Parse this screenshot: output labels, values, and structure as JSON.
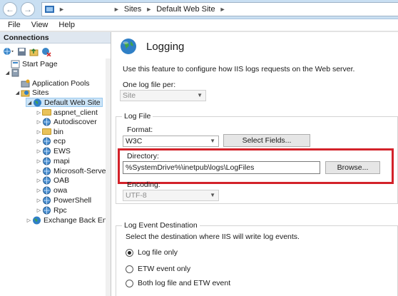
{
  "address_bar": {
    "crumbs": [
      "Sites",
      "Default Web Site"
    ]
  },
  "menu": [
    "File",
    "View",
    "Help"
  ],
  "connections": {
    "title": "Connections",
    "tree": [
      {
        "label": "Start Page",
        "icon": "start-page-icon",
        "depth": 0,
        "expand": ""
      },
      {
        "label": "",
        "icon": "server-icon",
        "depth": 0,
        "expand": "open"
      },
      {
        "label": "Application Pools",
        "icon": "app-pools-icon",
        "depth": 1,
        "expand": ""
      },
      {
        "label": "Sites",
        "icon": "sites-icon",
        "depth": 1,
        "expand": "open"
      },
      {
        "label": "Default Web Site",
        "icon": "globe-icon",
        "depth": 2,
        "expand": "open",
        "selected": true
      },
      {
        "label": "aspnet_client",
        "icon": "folder-icon",
        "depth": 3,
        "expand": "closed"
      },
      {
        "label": "Autodiscover",
        "icon": "app-icon",
        "depth": 3,
        "expand": "closed"
      },
      {
        "label": "bin",
        "icon": "folder-icon",
        "depth": 3,
        "expand": "closed"
      },
      {
        "label": "ecp",
        "icon": "app-icon",
        "depth": 3,
        "expand": "closed"
      },
      {
        "label": "EWS",
        "icon": "app-icon",
        "depth": 3,
        "expand": "closed"
      },
      {
        "label": "mapi",
        "icon": "app-icon",
        "depth": 3,
        "expand": "closed"
      },
      {
        "label": "Microsoft-Server-A",
        "icon": "app-icon",
        "depth": 3,
        "expand": "closed"
      },
      {
        "label": "OAB",
        "icon": "app-icon",
        "depth": 3,
        "expand": "closed"
      },
      {
        "label": "owa",
        "icon": "app-icon",
        "depth": 3,
        "expand": "closed"
      },
      {
        "label": "PowerShell",
        "icon": "app-icon",
        "depth": 3,
        "expand": "closed"
      },
      {
        "label": "Rpc",
        "icon": "app-icon",
        "depth": 3,
        "expand": "closed"
      },
      {
        "label": "Exchange Back End",
        "icon": "globe-icon",
        "depth": 2,
        "expand": "closed"
      }
    ]
  },
  "main": {
    "title": "Logging",
    "description": "Use this feature to configure how IIS logs requests on the Web server.",
    "one_log_label": "One log file per:",
    "one_log_value": "Site",
    "log_file_group": "Log File",
    "format_label": "Format:",
    "format_value": "W3C",
    "select_fields_label": "Select Fields...",
    "directory_label": "Directory:",
    "directory_value": "%SystemDrive%\\inetpub\\logs\\LogFiles",
    "browse_label": "Browse...",
    "encoding_label": "Encoding:",
    "encoding_value": "UTF-8",
    "event_group": "Log Event Destination",
    "event_desc": "Select the destination where IIS will write log events.",
    "radios": [
      {
        "label": "Log file only",
        "checked": true
      },
      {
        "label": "ETW event only",
        "checked": false
      },
      {
        "label": "Both log file and ETW event",
        "checked": false
      }
    ]
  },
  "colors": {
    "highlight_box": "#d3222a",
    "title_bar": "#c9dff2",
    "selection": "#cce4f7"
  }
}
